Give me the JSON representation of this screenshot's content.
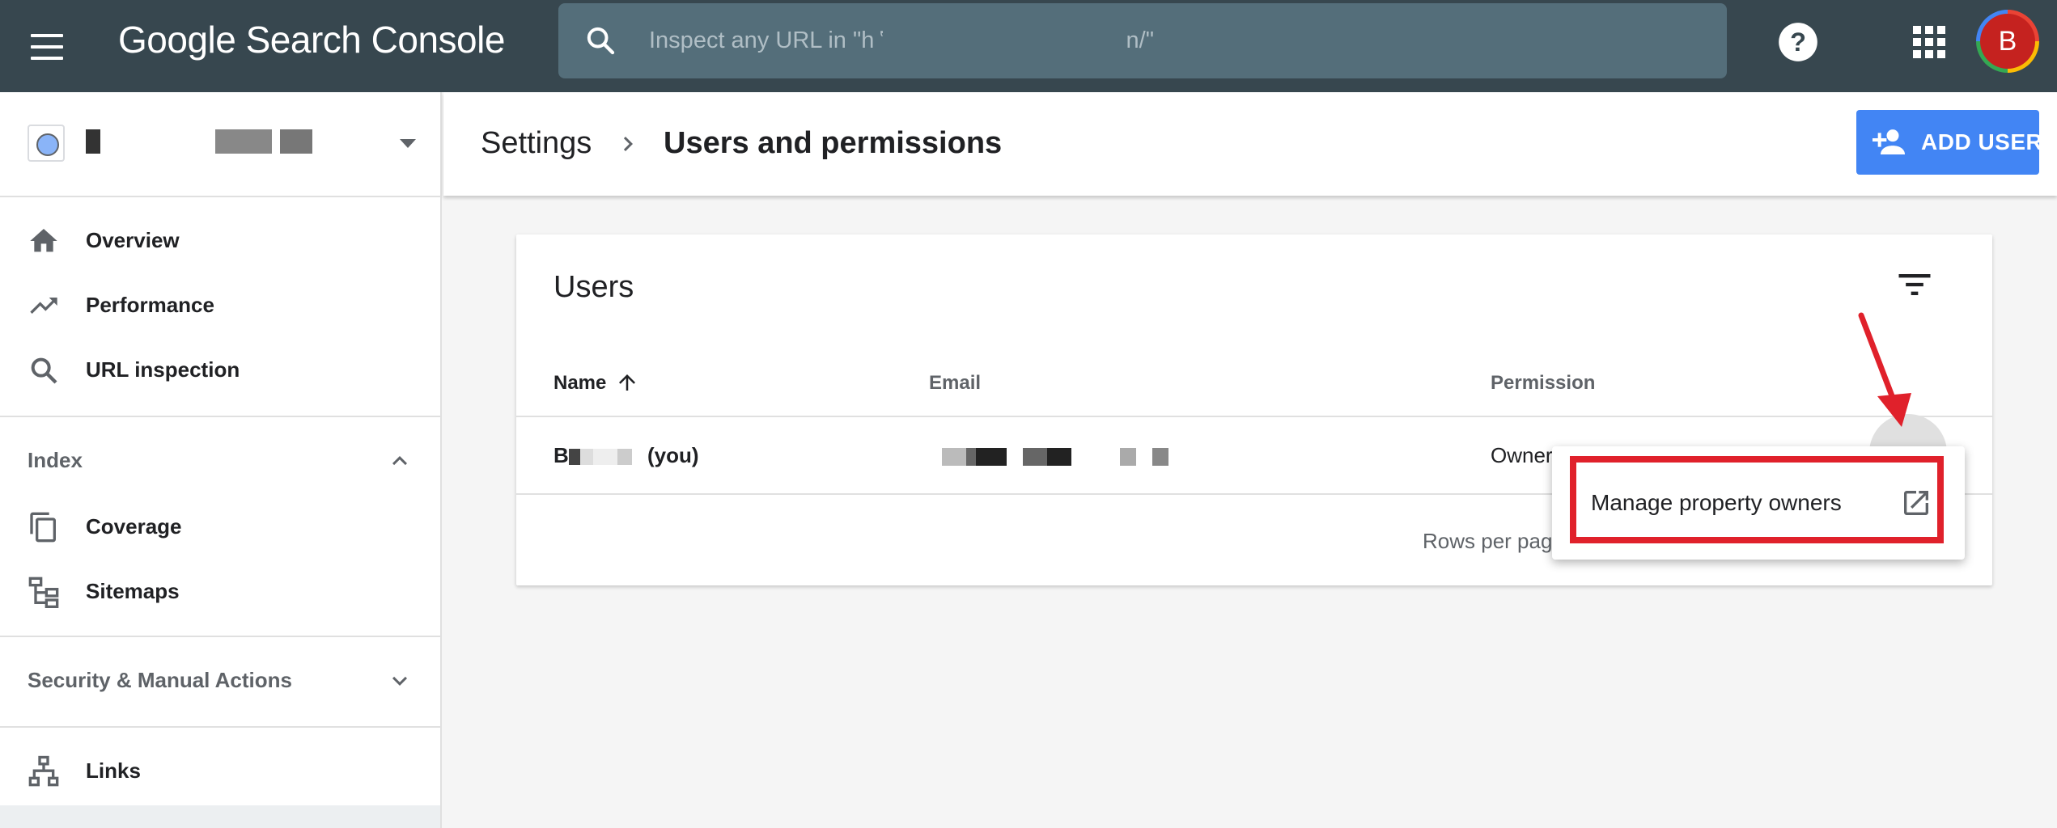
{
  "topbar": {
    "app_title": "Google Search Console",
    "search_placeholder": "Inspect any URL in \"h ʽ                                      n/\"",
    "avatar_initial": "B"
  },
  "sidebar": {
    "property_name": "",
    "items_top": [
      {
        "label": "Overview",
        "icon": "home-icon"
      },
      {
        "label": "Performance",
        "icon": "trending-up-icon"
      },
      {
        "label": "URL inspection",
        "icon": "search-icon"
      }
    ],
    "section_index": "Index",
    "items_index": [
      {
        "label": "Coverage",
        "icon": "copy-icon"
      },
      {
        "label": "Sitemaps",
        "icon": "sitemap-icon"
      }
    ],
    "section_security": "Security & Manual Actions",
    "items_bottom": [
      {
        "label": "Links",
        "icon": "links-icon"
      }
    ]
  },
  "header": {
    "breadcrumb_parent": "Settings",
    "breadcrumb_current": "Users and permissions",
    "add_user_label": "ADD USER"
  },
  "users_card": {
    "title": "Users",
    "columns": {
      "name": "Name",
      "email": "Email",
      "permission": "Permission"
    },
    "rows": [
      {
        "name_prefix": "B",
        "name_suffix": "(you)",
        "email": "",
        "permission": "Owner"
      }
    ],
    "rows_per_page_label": "Rows per pag"
  },
  "menu": {
    "item_label": "Manage property owners"
  },
  "colors": {
    "topbar": "#37474f",
    "search_bg": "#546e7a",
    "accent": "#4285f4",
    "highlight": "#e0212b"
  }
}
